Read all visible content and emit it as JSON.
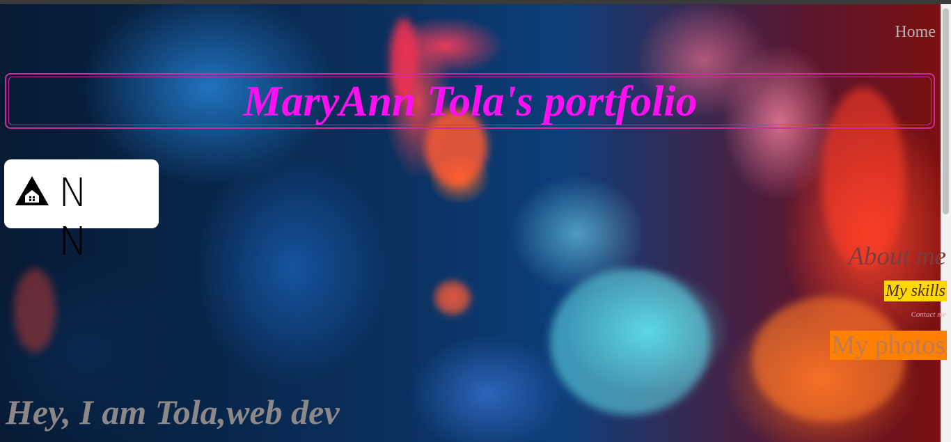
{
  "nav": {
    "home": "Home",
    "about": "About me",
    "skills": "My skills",
    "contact": "Contact me",
    "photos": "My photos"
  },
  "header": {
    "title": "MaryAnn Tola's portfolio"
  },
  "logo": {
    "text": "N N",
    "icon": "house-triangle-icon"
  },
  "hero": {
    "text": "Hey, I am Tola,web dev"
  },
  "colors": {
    "title": "#ff10f0",
    "title_border": "#d02aa0",
    "skills_bg": "#ffd800",
    "photos_bg": "#ff8000"
  }
}
